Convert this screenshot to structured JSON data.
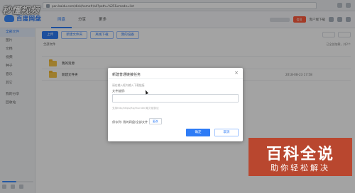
{
  "watermark": {
    "logo_text": "秒懂视频",
    "badge_main": "百科全说",
    "badge_sub": "助你轻松解决"
  },
  "browser": {
    "url": "pan.baidu.com/disk/home#/all?path=%2F&vmode=list"
  },
  "header": {
    "brand": "百度网盘",
    "tabs": [
      {
        "label": "网盘"
      },
      {
        "label": "分享"
      },
      {
        "label": "更多"
      }
    ],
    "vip_label": "会员",
    "client_download": "客户端下载"
  },
  "sidebar": {
    "items": [
      {
        "label": "全部文件"
      },
      {
        "label": "图片"
      },
      {
        "label": "文档"
      },
      {
        "label": "视频"
      },
      {
        "label": "种子"
      },
      {
        "label": "音乐"
      },
      {
        "label": "其它"
      },
      {
        "label": "我的分享"
      },
      {
        "label": "回收站"
      }
    ],
    "quota_fraction": 0.46
  },
  "toolbar": {
    "upload": "上传",
    "new_folder": "新建文件夹",
    "offline_download": "离线下载",
    "my_devices": "我的设备"
  },
  "breadcrumb": "全部文件",
  "loaded_info": "已全部加载，共2个",
  "files": [
    {
      "name": "我的资源",
      "time": ""
    },
    {
      "name": "新建文件夹",
      "time": "2018-08-23 17:58"
    }
  ],
  "dialog": {
    "title": "新建普通链接任务",
    "hint": "请在输入框内输入下载链接",
    "label": "文件链接:",
    "input_value": "",
    "help": "支持http/https/ftp/thunder/磁力链协议",
    "save_to": "保存到:  我的网盘/全部文件",
    "change": "更改",
    "ok": "确定",
    "cancel": "取消"
  }
}
